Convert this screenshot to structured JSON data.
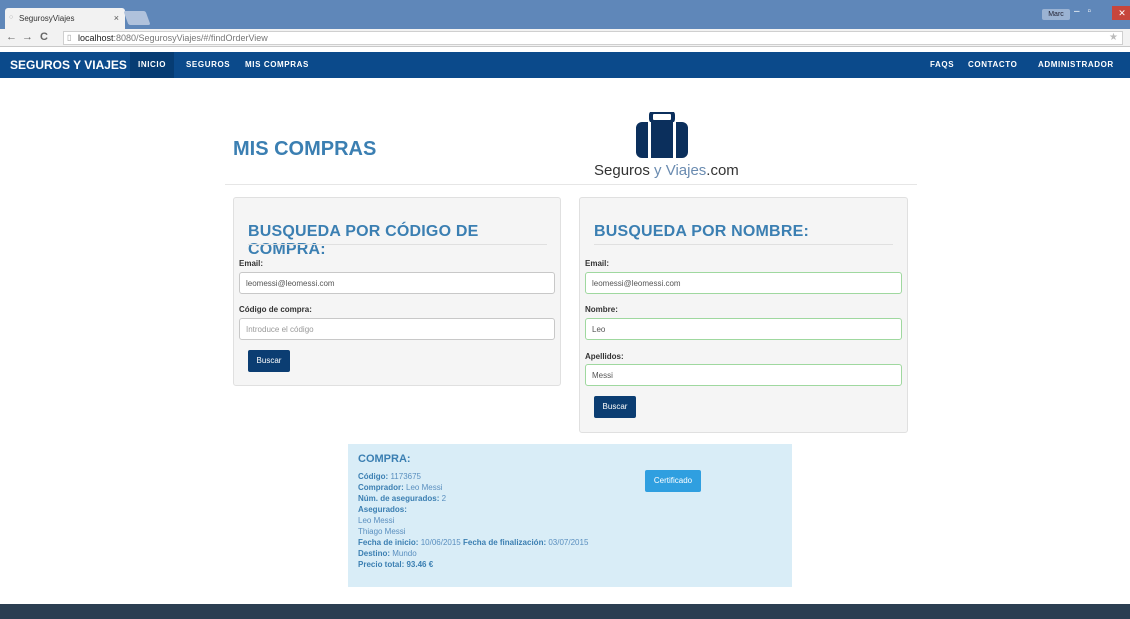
{
  "browser": {
    "tab_title": "SegurosyViajes",
    "tab_close": "×",
    "user_badge": "Marc",
    "url_host": "localhost",
    "url_path": ":8080/SegurosyViajes/#/findOrderView"
  },
  "navbar": {
    "brand": "SEGUROS Y VIAJES",
    "links": [
      "INICIO",
      "SEGUROS",
      "MIS COMPRAS"
    ],
    "right_links": [
      "FAQS",
      "CONTACTO",
      "ADMINISTRADOR"
    ]
  },
  "header": {
    "title": "MIS COMPRAS",
    "logo_bold": "Seguros",
    "logo_light": " y Viajes",
    "logo_suffix": ".com"
  },
  "search_code": {
    "title": "BUSQUEDA POR CÓDIGO DE COMPRA:",
    "email_label": "Email:",
    "email_value": "leomessi@leomessi.com",
    "code_label": "Código de compra:",
    "code_placeholder": "Introduce el código",
    "button": "Buscar"
  },
  "search_name": {
    "title": "BUSQUEDA POR NOMBRE:",
    "email_label": "Email:",
    "email_value": "leomessi@leomessi.com",
    "name_label": "Nombre:",
    "name_value": "Leo",
    "surname_label": "Apellidos:",
    "surname_value": "Messi",
    "button": "Buscar"
  },
  "result": {
    "title": "COMPRA:",
    "code_label": "Código:",
    "code": "1173675",
    "buyer_label": "Comprador:",
    "buyer": "Leo Messi",
    "num_label": "Núm. de asegurados:",
    "num": "2",
    "insured_label": "Asegurados:",
    "insured": [
      "Leo Messi",
      "Thiago Messi"
    ],
    "start_label": "Fecha de inicio:",
    "start": "10/06/2015",
    "end_label": "Fecha de finalización:",
    "end": "03/07/2015",
    "dest_label": "Destino:",
    "dest": "Mundo",
    "price_label": "Precio total:",
    "price": "93.46 €",
    "cert_button": "Certificado"
  },
  "colors": {
    "navbar": "#0b4a8b",
    "title_blue": "#3b7fb2",
    "button_dark": "#0b3d72",
    "result_bg": "#d9edf7",
    "cert_button": "#2f9fe0"
  }
}
